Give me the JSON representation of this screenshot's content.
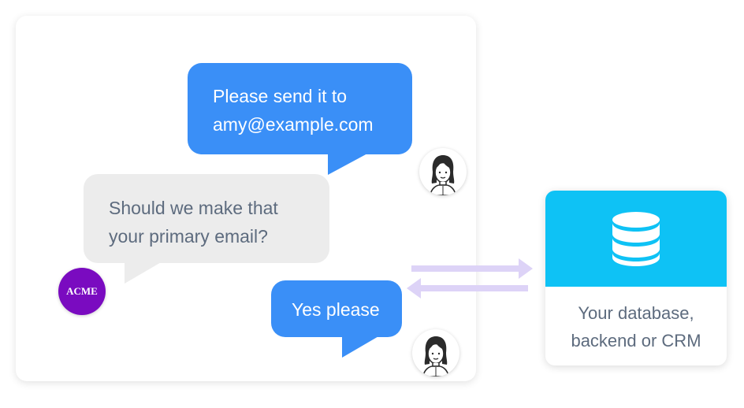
{
  "conversation": {
    "user_message_1": [
      "Please send it to",
      "amy@example.com"
    ],
    "bot_message": [
      "Should we make that",
      "your primary email?"
    ],
    "user_message_2": "Yes please",
    "bot_logo_text": "ACME"
  },
  "backend": {
    "label_lines": [
      "Your database,",
      "backend or CRM"
    ],
    "icon": "database-icon"
  },
  "colors": {
    "user_bubble": "#3a8ff7",
    "bot_bubble": "#ececec",
    "db_header": "#0ec2f5",
    "acme_logo": "#7a0bc0",
    "arrows": "#ddd3f7"
  }
}
